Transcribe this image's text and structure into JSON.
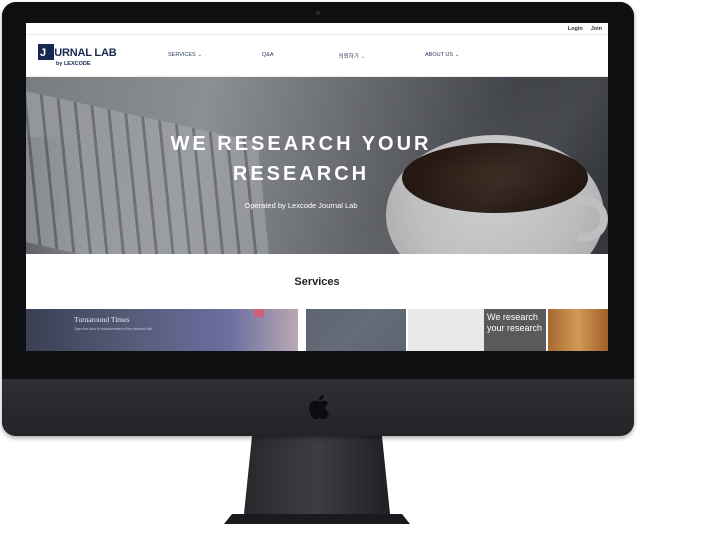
{
  "topbar": {
    "login": "Login",
    "join": "Join"
  },
  "logo": {
    "first_letter": "J",
    "rest": "OURNAL LAB",
    "sub": "by LEXCODE"
  },
  "nav": [
    {
      "label": "SERVICES",
      "chevron": "⌄"
    },
    {
      "label": "Q&A",
      "chevron": ""
    },
    {
      "label": "의뢰하기",
      "chevron": "⌄"
    },
    {
      "label": "ABOUT US",
      "chevron": "⌄"
    }
  ],
  "hero": {
    "title_line1": "WE RESEARCH YOUR",
    "title_line2": "RESEARCH",
    "subtitle": "Operated by Lexcode Journal Lab"
  },
  "services": {
    "title": "Services"
  },
  "cards": {
    "card1_title": "Turnaround Times",
    "card1_sub": "Open the door to enhancement of the research life",
    "card4_text": "We research your research"
  },
  "colors": {
    "brand_navy": "#16284f",
    "monitor": "#1f2124"
  }
}
